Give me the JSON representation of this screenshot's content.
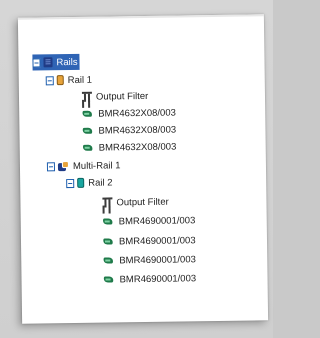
{
  "tree": {
    "items": [
      {
        "label": "Rails",
        "kind": "rails-root",
        "selected": true
      },
      {
        "label": "Rail 1",
        "kind": "rail"
      },
      {
        "label": "Output Filter",
        "kind": "output-filter"
      },
      {
        "label": "BMR4632X08/003",
        "kind": "module"
      },
      {
        "label": "BMR4632X08/003",
        "kind": "module"
      },
      {
        "label": "BMR4632X08/003",
        "kind": "module"
      },
      {
        "label": "Multi-Rail 1",
        "kind": "multi-rail"
      },
      {
        "label": "Rail 2",
        "kind": "rail"
      },
      {
        "label": "Output Filter",
        "kind": "output-filter"
      },
      {
        "label": "BMR4690001/003",
        "kind": "module"
      },
      {
        "label": "BMR4690001/003",
        "kind": "module"
      },
      {
        "label": "BMR4690001/003",
        "kind": "module"
      },
      {
        "label": "BMR4690001/003",
        "kind": "module"
      }
    ]
  },
  "icons": {
    "rails-root": "rails-icon",
    "rail-1": "rail-orange-icon",
    "rail-2": "rail-teal-icon",
    "multi-rail": "multi-rail-icon",
    "output-filter": "output-filter-icon",
    "module": "module-icon"
  },
  "colors": {
    "selection": "#2f64b5",
    "expander": "#1f5fae",
    "rails_icon": "#1f3b86",
    "rail1_icon": "#e7a33a",
    "rail2_icon": "#1aa6a0",
    "module_icon": "#1f7a4a"
  }
}
